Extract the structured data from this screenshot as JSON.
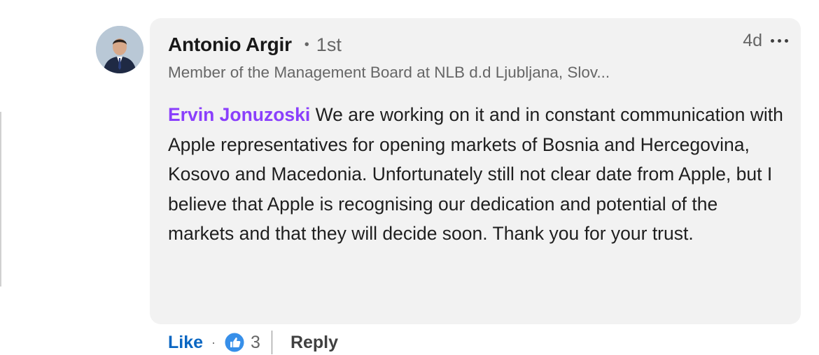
{
  "comment": {
    "author": {
      "name": "Antonio Argir",
      "degree": "1st",
      "headline": "Member of the Management Board at NLB d.d Ljubljana, Slov..."
    },
    "time": "4d",
    "more_icon": "more-horizontal-icon",
    "mention": "Ervin Jonuzoski",
    "text": " We are working on it and in constant communication with Apple representatives for opening markets of Bosnia and Hercegovina, Kosovo and Macedonia. Unfortunately still not clear date from Apple, but I believe that Apple is recognising our dedication and potential of the markets and that they will decide soon. Thank you for your trust."
  },
  "actions": {
    "like_label": "Like",
    "separator": "·",
    "reaction_icon": "like-reaction-icon",
    "reaction_count": "3",
    "reply_label": "Reply"
  },
  "colors": {
    "like_blue": "#0a66c2",
    "mention_purple": "#8a3ffc",
    "bubble_bg": "#f2f2f2"
  }
}
